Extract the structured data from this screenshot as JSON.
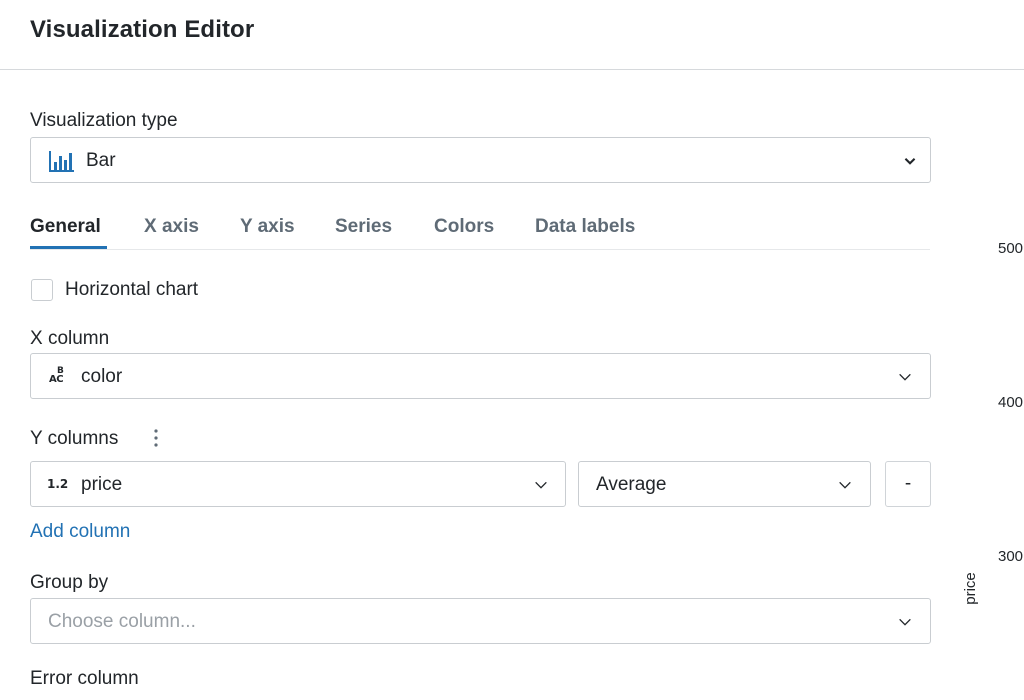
{
  "header": {
    "title": "Visualization Editor"
  },
  "viz_type": {
    "label": "Visualization type",
    "value": "Bar",
    "icon": "bar-chart-icon"
  },
  "tabs": [
    {
      "label": "General",
      "active": true
    },
    {
      "label": "X axis"
    },
    {
      "label": "Y axis"
    },
    {
      "label": "Series"
    },
    {
      "label": "Colors"
    },
    {
      "label": "Data labels"
    }
  ],
  "horizontal_chart": {
    "label": "Horizontal chart",
    "checked": false
  },
  "x_column": {
    "label": "X column",
    "value": "color",
    "type_icon_top": "B",
    "type_icon_bottom": "AC"
  },
  "y_columns": {
    "label": "Y columns",
    "column": "price",
    "type_icon": "1.2",
    "aggregation": "Average",
    "remove_label": "-"
  },
  "add_column": "Add column",
  "group_by": {
    "label": "Group by",
    "placeholder": "Choose column..."
  },
  "error_column": {
    "label": "Error column"
  },
  "chart_preview": {
    "ticks": [
      "500",
      "400",
      "300"
    ],
    "y_label": "price"
  },
  "colors": {
    "accent": "#2272b4",
    "border": "#c9cdd1",
    "text": "#22262a",
    "muted": "#5f6b76"
  }
}
